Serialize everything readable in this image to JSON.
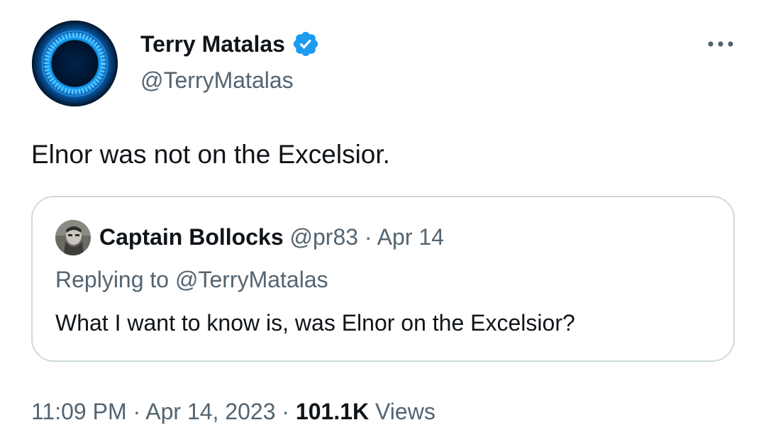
{
  "author": {
    "display_name": "Terry Matalas",
    "handle": "@TerryMatalas",
    "avatar_icon": "blue-ring-light-avatar",
    "verified_icon": "verified-badge-icon",
    "verified_color": "#1d9bf0"
  },
  "tweet": {
    "text": "Elnor was not on the Excelsior.",
    "time": "11:09 PM",
    "separator": "·",
    "date": "Apr 14, 2023",
    "views_count": "101.1K",
    "views_label": "Views"
  },
  "more_icon": "more-horizontal-icon",
  "quote": {
    "avatar_icon": "grayscale-portrait-avatar",
    "display_name": "Captain Bollocks",
    "handle": "@pr83",
    "separator": "·",
    "date": "Apr 14",
    "replying_to": "Replying to @TerryMatalas",
    "text": "What I want to know is, was Elnor on the Excelsior?"
  },
  "colors": {
    "text_primary": "#0f1419",
    "text_secondary": "#536471",
    "border": "#cfd9de",
    "accent": "#1d9bf0"
  }
}
